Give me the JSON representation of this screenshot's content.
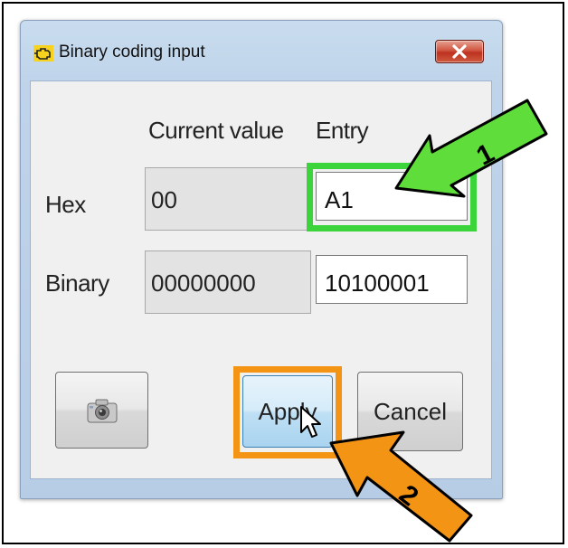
{
  "window": {
    "title": "Binary coding input"
  },
  "headers": {
    "current_value": "Current value",
    "entry": "Entry"
  },
  "rows": {
    "hex": {
      "label": "Hex",
      "current": "00",
      "entry": "A1"
    },
    "binary": {
      "label": "Binary",
      "current": "00000000",
      "entry": "10100001"
    }
  },
  "buttons": {
    "apply": "Apply",
    "cancel": "Cancel"
  },
  "annotations": {
    "arrow1_label": "1",
    "arrow2_label": "2"
  },
  "colors": {
    "highlight_green": "#3bd43b",
    "highlight_orange": "#f39415",
    "close_red": "#c9452f"
  },
  "icons": {
    "title": "engine-diagnostic-icon",
    "close": "close-icon",
    "screenshot": "camera-icon",
    "cursor": "mouse-pointer-icon"
  }
}
